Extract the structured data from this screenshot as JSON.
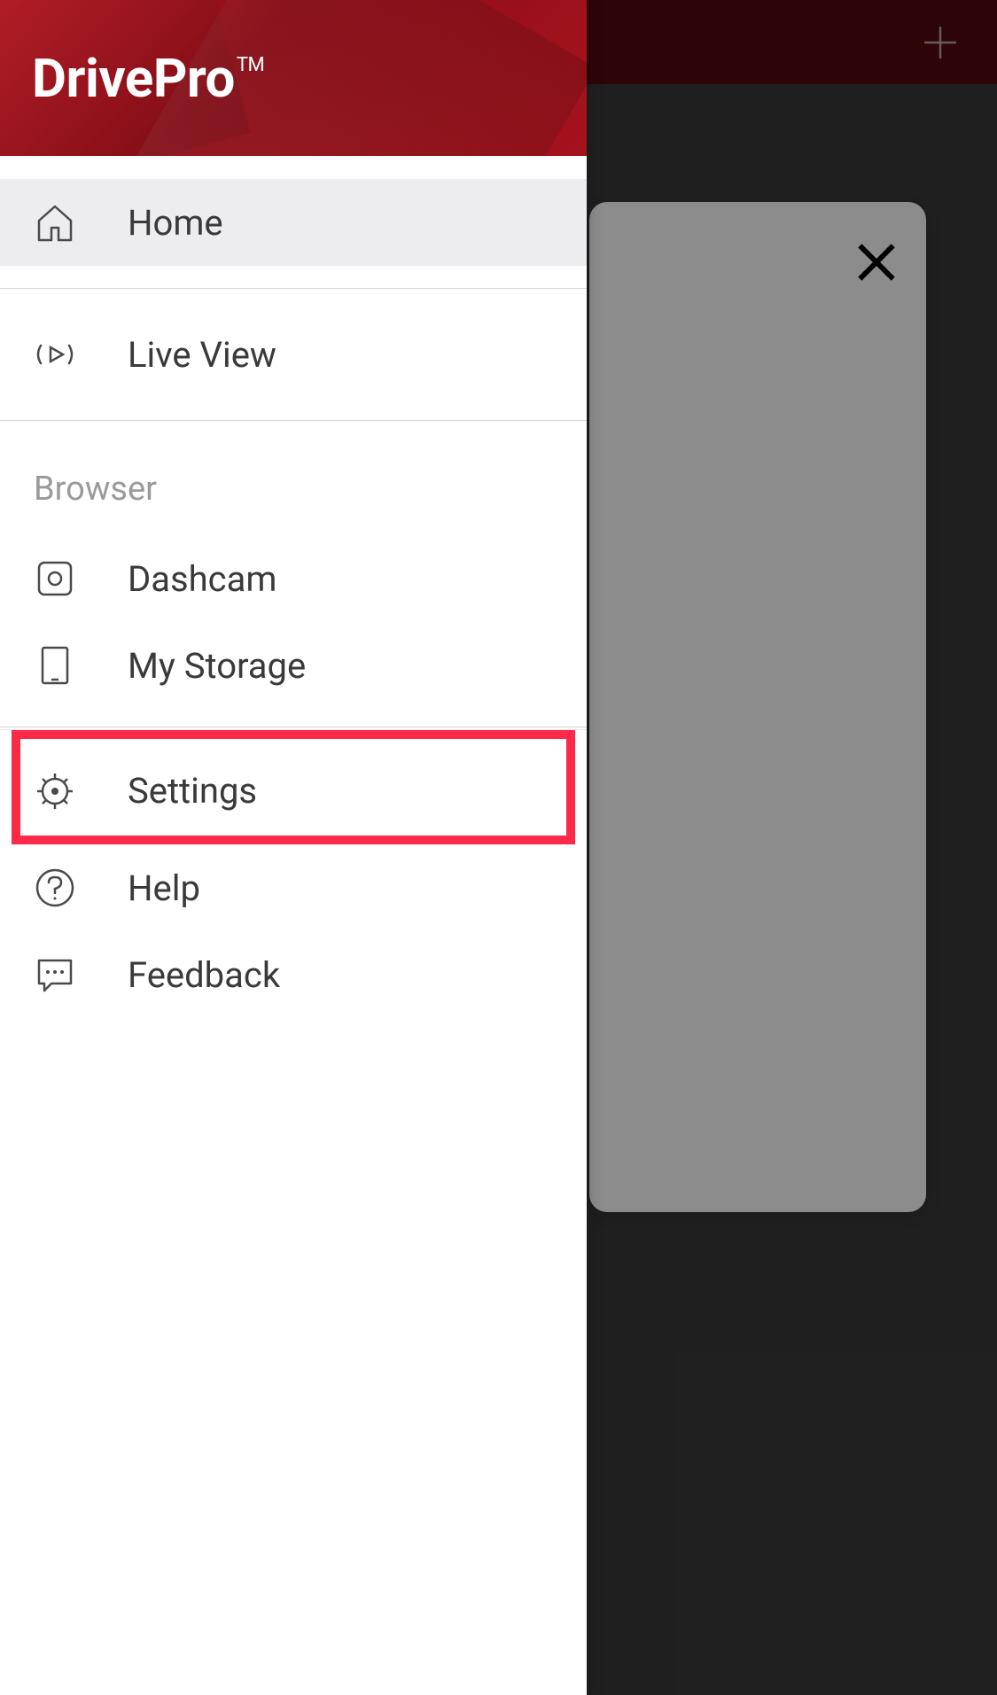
{
  "app": {
    "logo_text": "DrivePro",
    "logo_tm": "TM"
  },
  "menu": {
    "home": "Home",
    "live_view": "Live View",
    "section_browser": "Browser",
    "dashcam": "Dashcam",
    "my_storage": "My Storage",
    "settings": "Settings",
    "help": "Help",
    "feedback": "Feedback"
  }
}
